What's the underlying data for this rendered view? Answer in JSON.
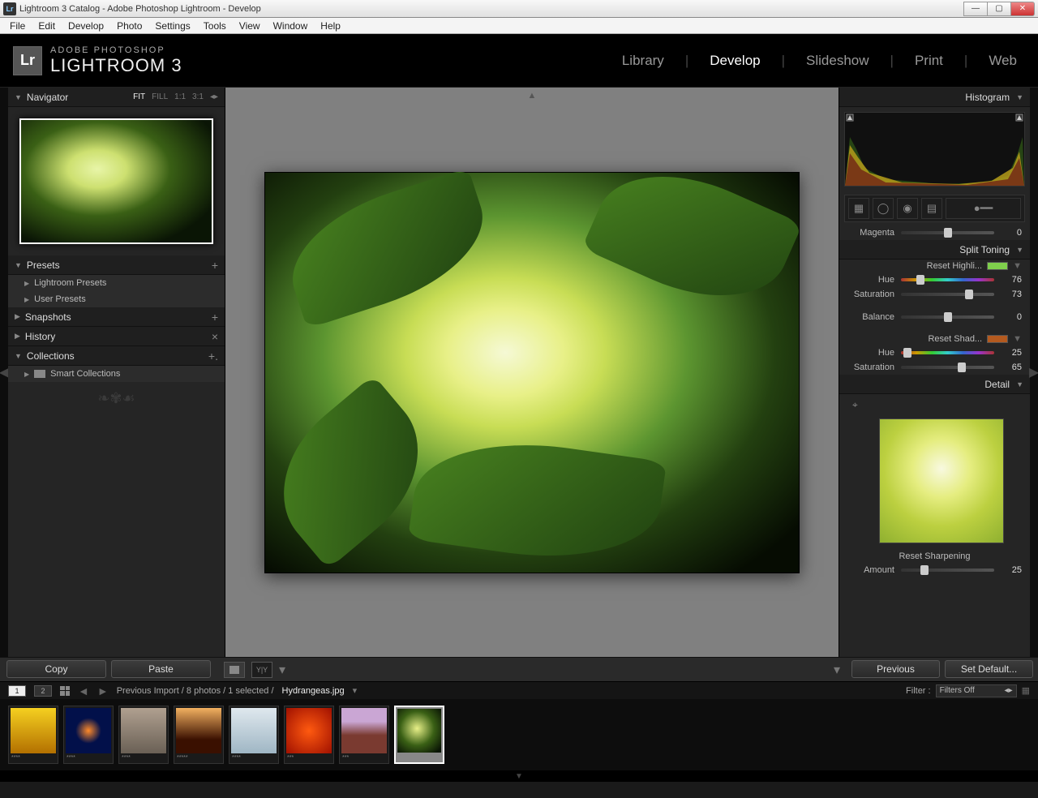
{
  "window": {
    "title": "Lightroom 3 Catalog - Adobe Photoshop Lightroom - Develop"
  },
  "menu": [
    "File",
    "Edit",
    "Develop",
    "Photo",
    "Settings",
    "Tools",
    "View",
    "Window",
    "Help"
  ],
  "brand": {
    "line1": "ADOBE PHOTOSHOP",
    "line2": "LIGHTROOM 3",
    "badge": "Lr"
  },
  "modules": [
    "Library",
    "Develop",
    "Slideshow",
    "Print",
    "Web"
  ],
  "modules_active": "Develop",
  "nav": {
    "title": "Navigator",
    "opts": [
      "FIT",
      "FILL",
      "1:1",
      "3:1"
    ],
    "active": "FIT"
  },
  "left_panels": {
    "presets": {
      "title": "Presets",
      "items": [
        "Lightroom Presets",
        "User Presets"
      ]
    },
    "snapshots": {
      "title": "Snapshots"
    },
    "history": {
      "title": "History"
    },
    "collections": {
      "title": "Collections",
      "items": [
        "Smart Collections"
      ]
    }
  },
  "buttons": {
    "copy": "Copy",
    "paste": "Paste",
    "previous": "Previous",
    "setdefault": "Set Default..."
  },
  "right": {
    "histogram": "Histogram",
    "magenta": {
      "label": "Magenta",
      "value": 0,
      "pos": 50
    },
    "split": {
      "title": "Split Toning",
      "reset_hi": "Reset Highli...",
      "hi_hue": {
        "label": "Hue",
        "value": 76,
        "pos": 21
      },
      "hi_sat": {
        "label": "Saturation",
        "value": 73,
        "pos": 73
      },
      "balance": {
        "label": "Balance",
        "value": 0,
        "pos": 50
      },
      "reset_sh": "Reset Shad...",
      "sh_hue": {
        "label": "Hue",
        "value": 25,
        "pos": 7
      },
      "sh_sat": {
        "label": "Saturation",
        "value": 65,
        "pos": 65
      }
    },
    "detail": {
      "title": "Detail",
      "reset": "Reset Sharpening",
      "amount": {
        "label": "Amount",
        "value": 25,
        "pos": 25
      }
    }
  },
  "filmstrip_header": {
    "pages": [
      "1",
      "2"
    ],
    "crumb": "Previous Import / 8 photos / 1 selected /",
    "filename": "Hydrangeas.jpg",
    "filter_label": "Filter :",
    "filter_value": "Filters Off"
  },
  "filmstrip": [
    {
      "stars": "****",
      "bg": "linear-gradient(#f5d020,#b37000)"
    },
    {
      "stars": "****",
      "bg": "radial-gradient(circle at 50% 50%,#ff8a2a 0%,#02104a 40%)"
    },
    {
      "stars": "****",
      "bg": "linear-gradient(#b0a090,#6a6055)"
    },
    {
      "stars": "*****",
      "bg": "linear-gradient(#f2b060,#3a1000 70%)"
    },
    {
      "stars": "****",
      "bg": "linear-gradient(#dfe8ee,#9fb6c4)"
    },
    {
      "stars": "***",
      "bg": "radial-gradient(circle,#ff5a10,#a01000)"
    },
    {
      "stars": "***",
      "bg": "linear-gradient(#caa6d4 30%,#7a3a30 60%)"
    },
    {
      "stars": "***",
      "bg": "radial-gradient(ellipse at 45% 45%,#e8f088 0%,#3a6015 50%,#0a1505 90%)",
      "selected": true
    }
  ]
}
